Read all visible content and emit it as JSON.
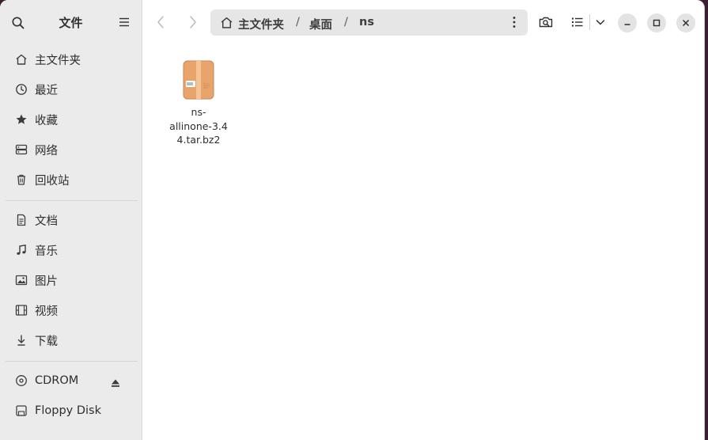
{
  "sidebar": {
    "title": "文件",
    "places": [
      {
        "label": "主文件夹",
        "icon": "home-icon"
      },
      {
        "label": "最近",
        "icon": "clock-icon"
      },
      {
        "label": "收藏",
        "icon": "star-icon"
      },
      {
        "label": "网络",
        "icon": "network-icon"
      },
      {
        "label": "回收站",
        "icon": "trash-icon"
      }
    ],
    "folders": [
      {
        "label": "文档",
        "icon": "document-icon"
      },
      {
        "label": "音乐",
        "icon": "music-icon"
      },
      {
        "label": "图片",
        "icon": "picture-icon"
      },
      {
        "label": "视频",
        "icon": "video-icon"
      },
      {
        "label": "下载",
        "icon": "download-icon"
      }
    ],
    "devices": [
      {
        "label": "CDROM",
        "icon": "disc-icon"
      },
      {
        "label": "Floppy Disk",
        "icon": "floppy-icon"
      }
    ]
  },
  "path": {
    "home": "主文件夹",
    "segments": [
      "桌面",
      "ns"
    ],
    "separator": "/"
  },
  "files": [
    {
      "name": "ns-allinone-3.44.tar.bz2",
      "name_lines": [
        "ns-",
        "allinone-3.4",
        "4.tar.bz2"
      ],
      "icon": "archive-icon"
    }
  ],
  "colors": {
    "sidebar_bg": "#ebebeb",
    "content_bg": "#ffffff",
    "archive_orange": "#e8a46b"
  }
}
